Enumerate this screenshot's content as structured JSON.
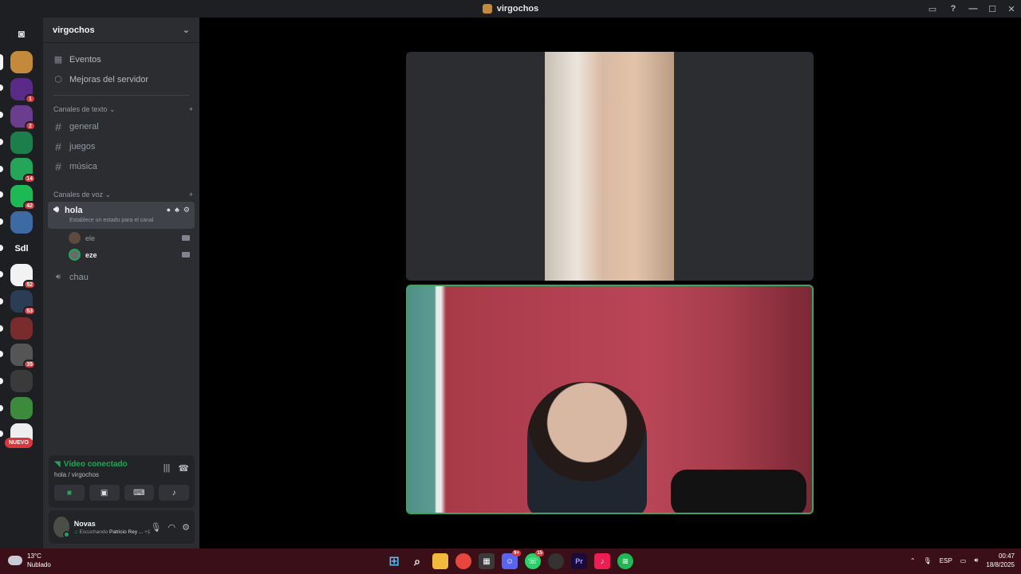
{
  "window": {
    "title": "virgochos"
  },
  "guilds": {
    "items": [
      {
        "name": "guild-avatar-1",
        "badge": "",
        "color": "#c28a3a",
        "top": 0
      },
      {
        "name": "guild-avatar-2",
        "badge": "1",
        "color": "#5b2a86"
      },
      {
        "name": "guild-avatar-3",
        "badge": "2",
        "color": "#6a3d8f"
      },
      {
        "name": "guild-avatar-4",
        "badge": "",
        "color": "#1a7f4b"
      },
      {
        "name": "guild-avatar-5",
        "badge": "14",
        "color": "#23a55a"
      },
      {
        "name": "guild-avatar-6",
        "badge": "42",
        "color": "#1db954"
      },
      {
        "name": "guild-avatar-7",
        "badge": "",
        "color": "#3e6aa3"
      },
      {
        "name": "guild-avatar-8",
        "badge": "",
        "label": "Sdl",
        "color": "#1e1f22"
      },
      {
        "name": "guild-avatar-9",
        "badge": "52",
        "color": "#f2f2f2"
      },
      {
        "name": "guild-avatar-10",
        "badge": "53",
        "color": "#2b3d55"
      },
      {
        "name": "guild-avatar-11",
        "badge": "",
        "color": "#7a2b2b"
      },
      {
        "name": "guild-avatar-12",
        "badge": "35",
        "color": "#555"
      },
      {
        "name": "guild-avatar-13",
        "badge": "",
        "color": "#3a3a3a"
      },
      {
        "name": "guild-avatar-14",
        "badge": "",
        "color": "#3c8a3c"
      },
      {
        "name": "guild-avatar-15",
        "badge": "",
        "color": "#eee"
      }
    ],
    "nuevo_label": "NUEVO",
    "sdl_label": "Sdl"
  },
  "sidebar": {
    "server_name": "virgochos",
    "links": [
      {
        "label": "Eventos"
      },
      {
        "label": "Mejoras del servidor"
      }
    ],
    "text_category": "Canales de texto",
    "text_channels": [
      {
        "label": "general"
      },
      {
        "label": "juegos"
      },
      {
        "label": "música"
      }
    ],
    "voice_category": "Canales de voz",
    "active_voice": {
      "label": "hola",
      "status": "Establece un estado para el canal"
    },
    "voice_users": [
      {
        "label": "ele"
      },
      {
        "label": "eze"
      }
    ],
    "other_voice": {
      "label": "chau"
    }
  },
  "rtc": {
    "status": "Vídeo conectado",
    "channel": "hola / virgochos"
  },
  "user": {
    "name": "Novas",
    "activity_prefix": "Escuchando",
    "activity_title": "Patricio Rey ...",
    "activity_extra": "+1"
  },
  "taskbar": {
    "weather_temp": "13°C",
    "weather_desc": "Nublado",
    "lang": "ESP",
    "time": "00:47",
    "date": "18/8/2025",
    "discord_badge": "9+",
    "whatsapp_badge": "15"
  }
}
